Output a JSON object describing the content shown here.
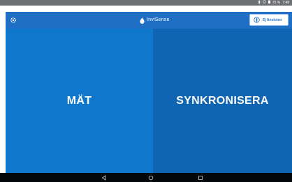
{
  "status_bar": {
    "icons": [
      "bluetooth-icon",
      "alarm-icon",
      "battery-icon"
    ],
    "battery": "75 %",
    "time": "7:48"
  },
  "app_bar": {
    "settings_icon": "gear-icon",
    "logo_text": "InviSense",
    "connection_label": "Ej Ansluten",
    "connection_icon": "sensor-icon"
  },
  "tiles": {
    "measure": "MÄT",
    "sync": "SYNKRONISERA"
  },
  "nav_bar": {
    "icons": [
      "back-icon",
      "home-icon",
      "recents-icon"
    ]
  },
  "colors": {
    "header": "#1f6fc4",
    "measure_tile": "#0f78cd",
    "sync_tile": "#0f65b1",
    "status_bar": "#6f7074",
    "nav_bar": "#050608"
  }
}
